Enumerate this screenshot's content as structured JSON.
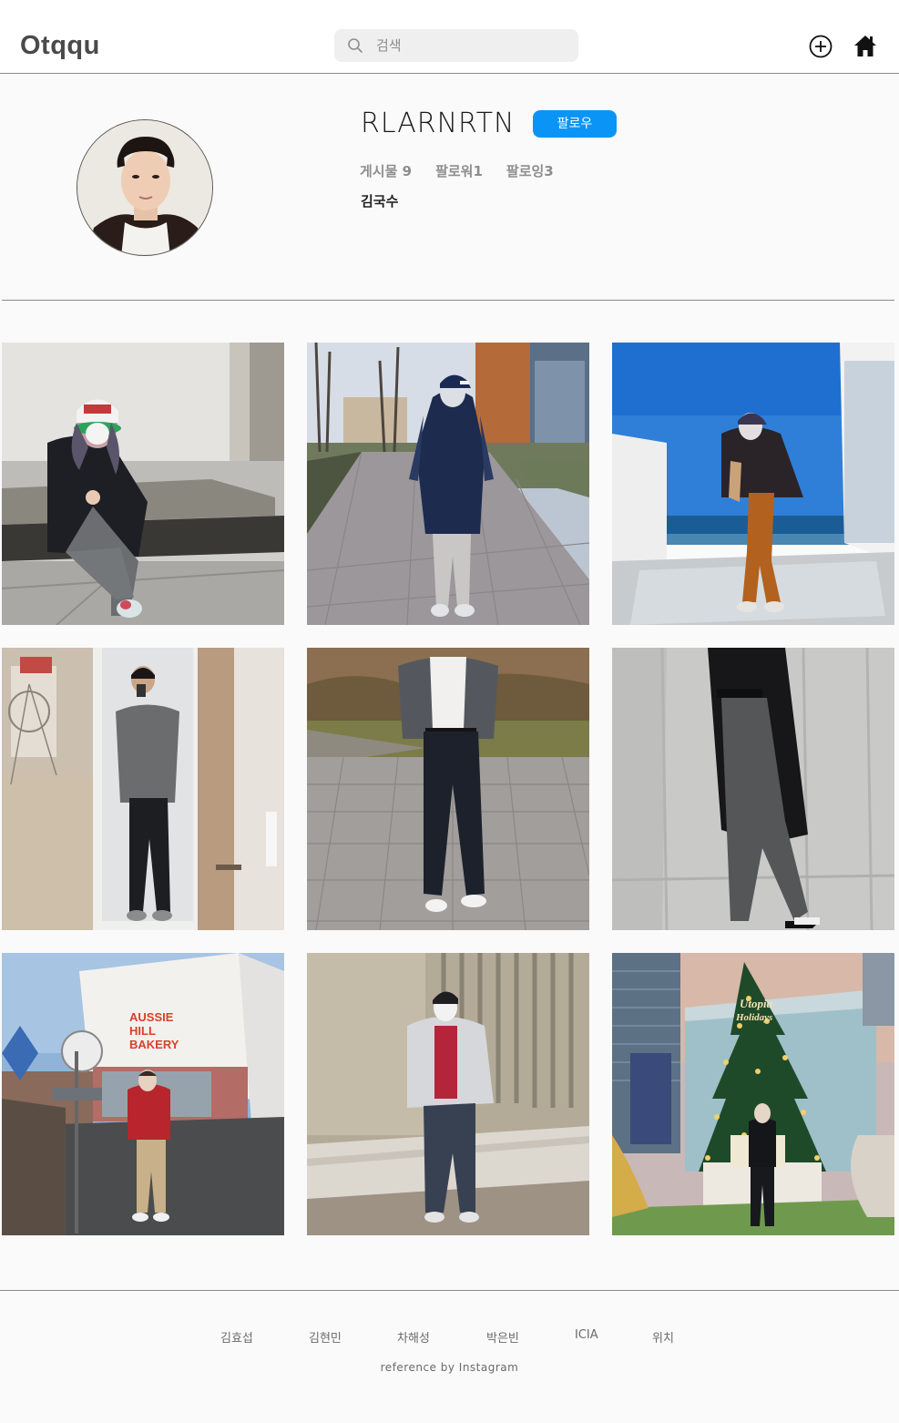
{
  "header": {
    "logo": "Otqqu",
    "search_placeholder": "검색",
    "add_icon": "plus-circle-icon",
    "home_icon": "home-icon"
  },
  "profile": {
    "username": "RLARNRTN",
    "follow_label": "팔로우",
    "posts_stat": "게시물 9",
    "followers_stat": "팔로워1",
    "following_stat": "팔로잉3",
    "full_name": "김국수"
  },
  "colors": {
    "accent": "#0a95f6",
    "background": "#fafafa",
    "divider": "#8a8a8a"
  },
  "posts": [
    {
      "content": "person-sitting-photo"
    },
    {
      "content": "person-street-coat-photo"
    },
    {
      "content": "person-beach-photo"
    },
    {
      "content": "person-door-mirror-photo"
    },
    {
      "content": "person-cardigan-photo"
    },
    {
      "content": "person-coat-wall-photo"
    },
    {
      "content": "aussie-hill-bakery-photo"
    },
    {
      "content": "person-puffer-wall-photo"
    },
    {
      "content": "christmas-tree-photo"
    }
  ],
  "photo_text": {
    "bakery_sign": [
      "AUSSIE",
      "HILL",
      "BAKERY"
    ],
    "tree_sign": [
      "Utopia",
      "Holidays"
    ]
  },
  "footer": {
    "links": [
      "김효섭",
      "김현민",
      "차해성",
      "박은빈",
      "ICIA",
      "위치"
    ],
    "reference": "reference by Instagram"
  }
}
